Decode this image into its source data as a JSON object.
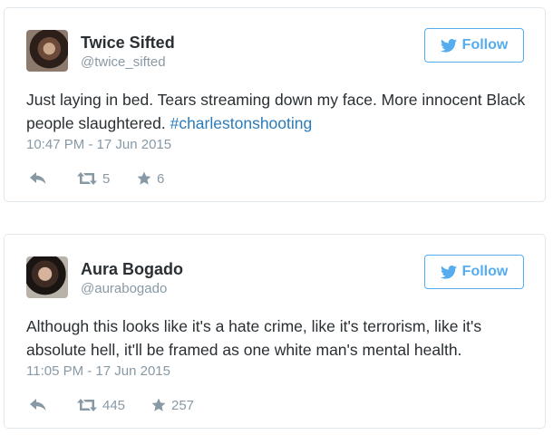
{
  "tweets": [
    {
      "display_name": "Twice Sifted",
      "screen_name": "@twice_sifted",
      "follow_label": "Follow",
      "text_plain": "Just laying in bed. Tears streaming down my face. More innocent Black people slaughtered. ",
      "hashtag": "#charlestonshooting",
      "timestamp": "10:47 PM - 17 Jun 2015",
      "retweets": "5",
      "likes": "6"
    },
    {
      "display_name": "Aura Bogado",
      "screen_name": "@aurabogado",
      "follow_label": "Follow",
      "text_plain": "Although this looks like it's a hate crime, like it's terrorism, like it's absolute hell, it'll be framed as one white man's mental health.",
      "timestamp": "11:05 PM - 17 Jun 2015",
      "retweets": "445",
      "likes": "257"
    }
  ],
  "colors": {
    "accent": "#55acee",
    "hashtag": "#2b7bb9",
    "meta_text": "#8899a6",
    "body_text": "#292f33",
    "border": "#e1e8ed"
  },
  "icons": {
    "follow": "twitter-bird-icon",
    "reply": "reply-arrow-icon",
    "retweet": "retweet-icon",
    "like": "star-icon"
  }
}
